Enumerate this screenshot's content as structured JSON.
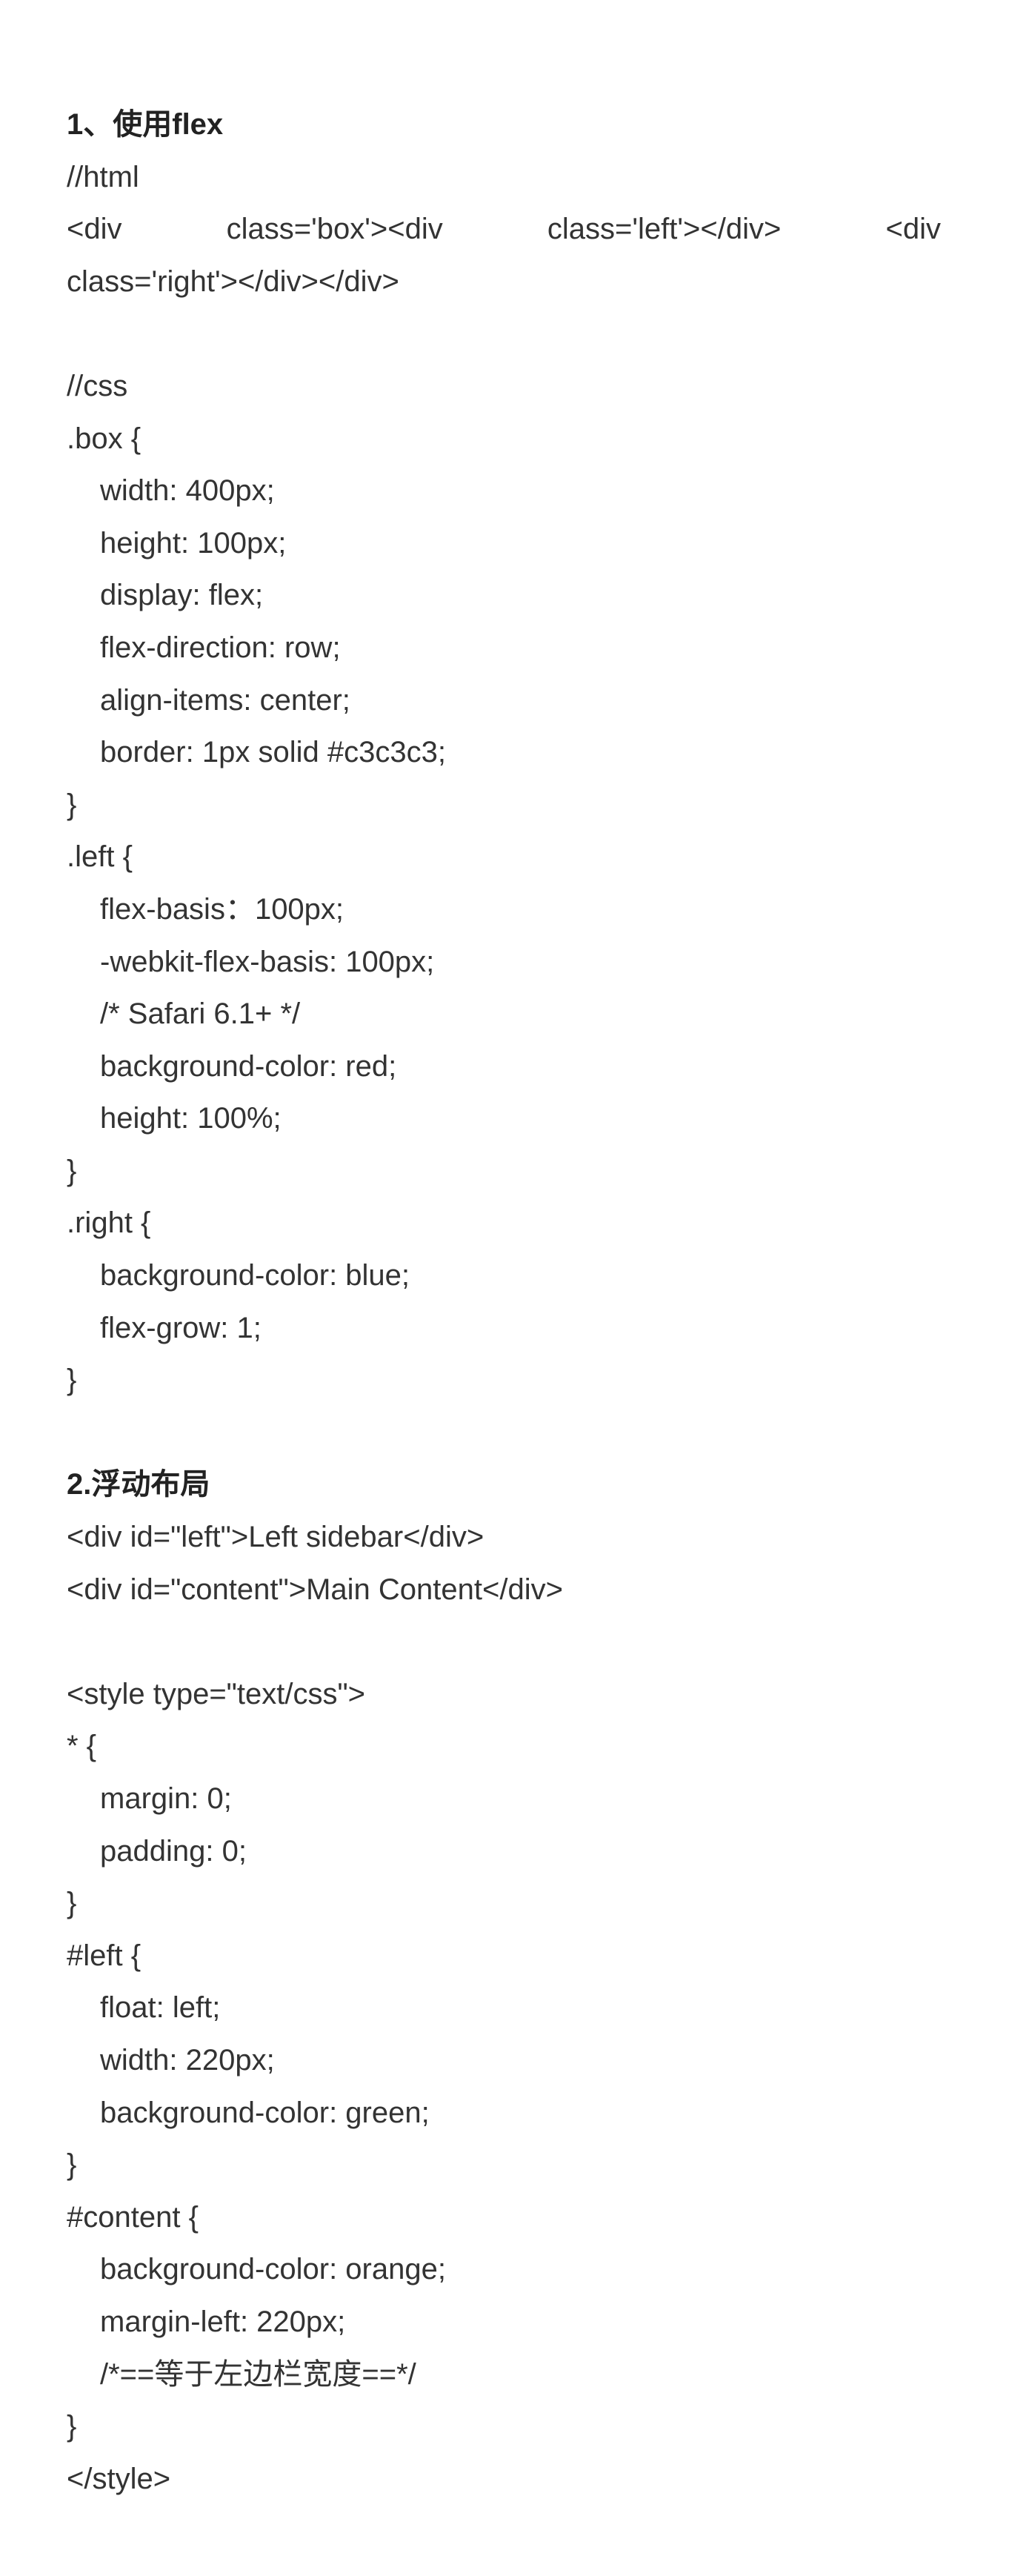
{
  "section1": {
    "heading": "1、使用flex",
    "html_comment": "//html",
    "html_line1_parts": [
      "<div",
      "class='box'><div",
      "class='left'></div>",
      "<div"
    ],
    "html_line2": "class='right'></div></div>",
    "css_comment": "//css",
    "box_open": ".box {",
    "box_props": [
      "width: 400px;",
      "height: 100px;",
      "display: flex;",
      "flex-direction: row;",
      "align-items: center;",
      "border: 1px solid #c3c3c3;"
    ],
    "box_close": "}",
    "left_open": ".left {",
    "left_props": [
      "flex-basis：100px;",
      "-webkit-flex-basis: 100px;",
      "/* Safari 6.1+ */",
      "background-color: red;",
      "height: 100%;"
    ],
    "left_close": "}",
    "right_open": ".right {",
    "right_props": [
      "background-color: blue;",
      "flex-grow: 1;"
    ],
    "right_close": "}"
  },
  "section2": {
    "heading": "2.浮动布局",
    "html_lines": [
      "<div id=\"left\">Left sidebar</div>",
      "<div id=\"content\">Main Content</div>"
    ],
    "style_open": "<style type=\"text/css\">",
    "star_open": "* {",
    "star_props": [
      "margin: 0;",
      "padding: 0;"
    ],
    "star_close": "}",
    "left_open": "#left {",
    "left_props": [
      "float: left;",
      "width: 220px;",
      "background-color: green;"
    ],
    "left_close": "}",
    "content_open": "#content {",
    "content_props": [
      "background-color: orange;",
      "margin-left: 220px;",
      "/*==等于左边栏宽度==*/"
    ],
    "content_close": "}",
    "style_close": "</style>"
  }
}
